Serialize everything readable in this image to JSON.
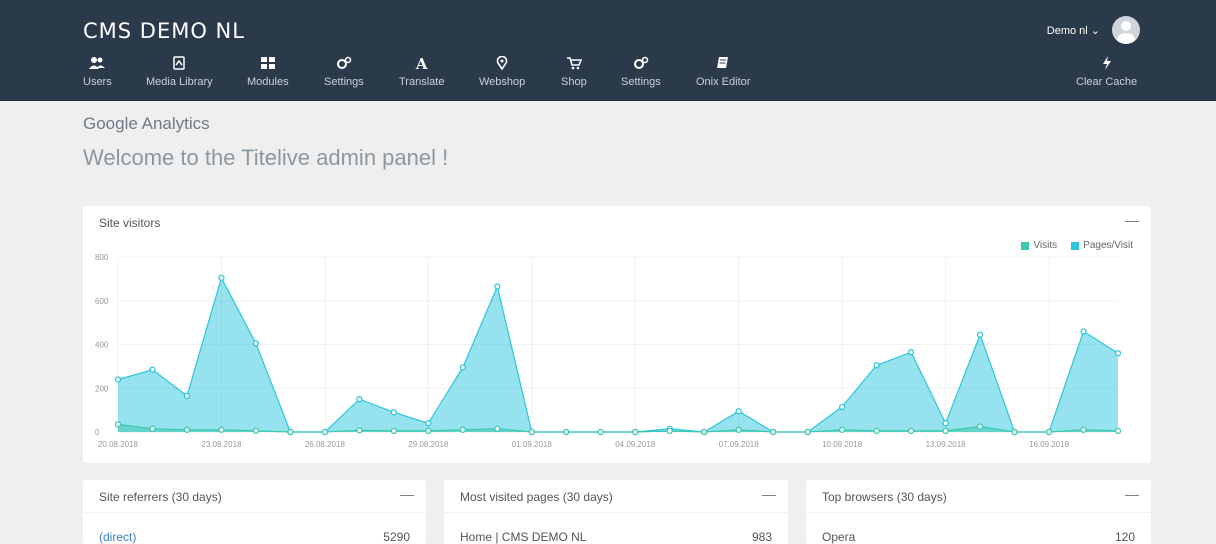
{
  "header": {
    "brand": "CMS DEMO NL",
    "user_name": "Demo nl ⌄",
    "nav": [
      {
        "label": "Users",
        "icon": "users-icon"
      },
      {
        "label": "Media Library",
        "icon": "media-icon"
      },
      {
        "label": "Modules",
        "icon": "modules-icon"
      },
      {
        "label": "Settings",
        "icon": "cogs-icon"
      },
      {
        "label": "Translate",
        "icon": "translate-icon"
      },
      {
        "label": "Webshop",
        "icon": "map-marker-icon"
      },
      {
        "label": "Shop",
        "icon": "cart-icon"
      },
      {
        "label": "Settings",
        "icon": "cogs-icon"
      },
      {
        "label": "Onix Editor",
        "icon": "book-icon"
      }
    ],
    "clear_cache": {
      "label": "Clear Cache",
      "icon": "bolt-icon"
    }
  },
  "page": {
    "section_title": "Google Analytics",
    "welcome": "Welcome to the Titelive admin panel !"
  },
  "visitors_panel": {
    "title": "Site visitors",
    "legend": [
      {
        "name": "Visits",
        "color": "#3cc8b0"
      },
      {
        "name": "Pages/Visit",
        "color": "#2dc6dd"
      }
    ]
  },
  "chart_data": {
    "type": "area",
    "title": "Site visitors",
    "ylim": [
      0,
      800
    ],
    "y_ticks": [
      "0",
      "200",
      "400",
      "600",
      "800"
    ],
    "x_tick_labels": [
      "20.08.2018",
      "23.08.2018",
      "26.08.2018",
      "29.08.2018",
      "01.09.2018",
      "04.09.2018",
      "07.09.2018",
      "10.09.2018",
      "13.09.2018",
      "16.09.2018"
    ],
    "x_tick_index": [
      0,
      3,
      6,
      9,
      12,
      15,
      18,
      21,
      24,
      27
    ],
    "grid": true,
    "legend_position": "top-right",
    "series": [
      {
        "name": "Pages/Visit",
        "color": "#2dc6dd",
        "values": [
          240,
          285,
          165,
          705,
          405,
          0,
          0,
          150,
          90,
          40,
          295,
          665,
          0,
          0,
          0,
          0,
          15,
          0,
          95,
          0,
          0,
          115,
          305,
          365,
          40,
          445,
          0,
          0,
          460,
          360
        ]
      },
      {
        "name": "Visits",
        "color": "#3cc8b0",
        "values": [
          35,
          15,
          10,
          10,
          5,
          0,
          0,
          8,
          5,
          5,
          10,
          15,
          0,
          0,
          0,
          0,
          5,
          0,
          10,
          0,
          0,
          10,
          5,
          5,
          5,
          25,
          0,
          0,
          10,
          5
        ]
      }
    ]
  },
  "referrers_panel": {
    "title": "Site referrers (30 days)",
    "rows": [
      {
        "label": "(direct)",
        "value": "5290"
      }
    ]
  },
  "pages_panel": {
    "title": "Most visited pages (30 days)",
    "rows": [
      {
        "label": "Home | CMS DEMO NL",
        "value": "983"
      }
    ]
  },
  "browsers_panel": {
    "title": "Top browsers (30 days)",
    "rows": [
      {
        "label": "Opera",
        "value": "120"
      }
    ]
  }
}
